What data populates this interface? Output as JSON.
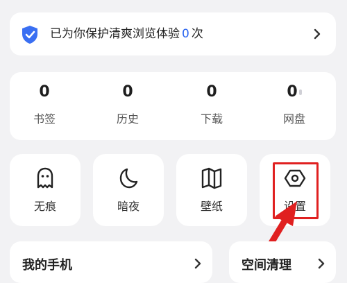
{
  "banner": {
    "text_before": "已为你保护清爽浏览体验",
    "count": "0",
    "text_after": "次",
    "icons": [
      "shield-icon",
      "chevron-right-icon"
    ],
    "accent": "#2c66f0"
  },
  "stats": [
    {
      "value": "0",
      "label": "书签"
    },
    {
      "value": "0",
      "label": "历史"
    },
    {
      "value": "0",
      "label": "下载"
    },
    {
      "value": "0",
      "label": "网盘"
    }
  ],
  "tools": [
    {
      "label": "无痕",
      "icon": "ghost-icon"
    },
    {
      "label": "暗夜",
      "icon": "moon-icon"
    },
    {
      "label": "壁纸",
      "icon": "book-icon"
    },
    {
      "label": "设置",
      "icon": "hexagon-gear-icon"
    }
  ],
  "bottom": {
    "my_phone": "我的手机",
    "cleanup": "空间清理"
  },
  "annotation_color": "#e02020"
}
